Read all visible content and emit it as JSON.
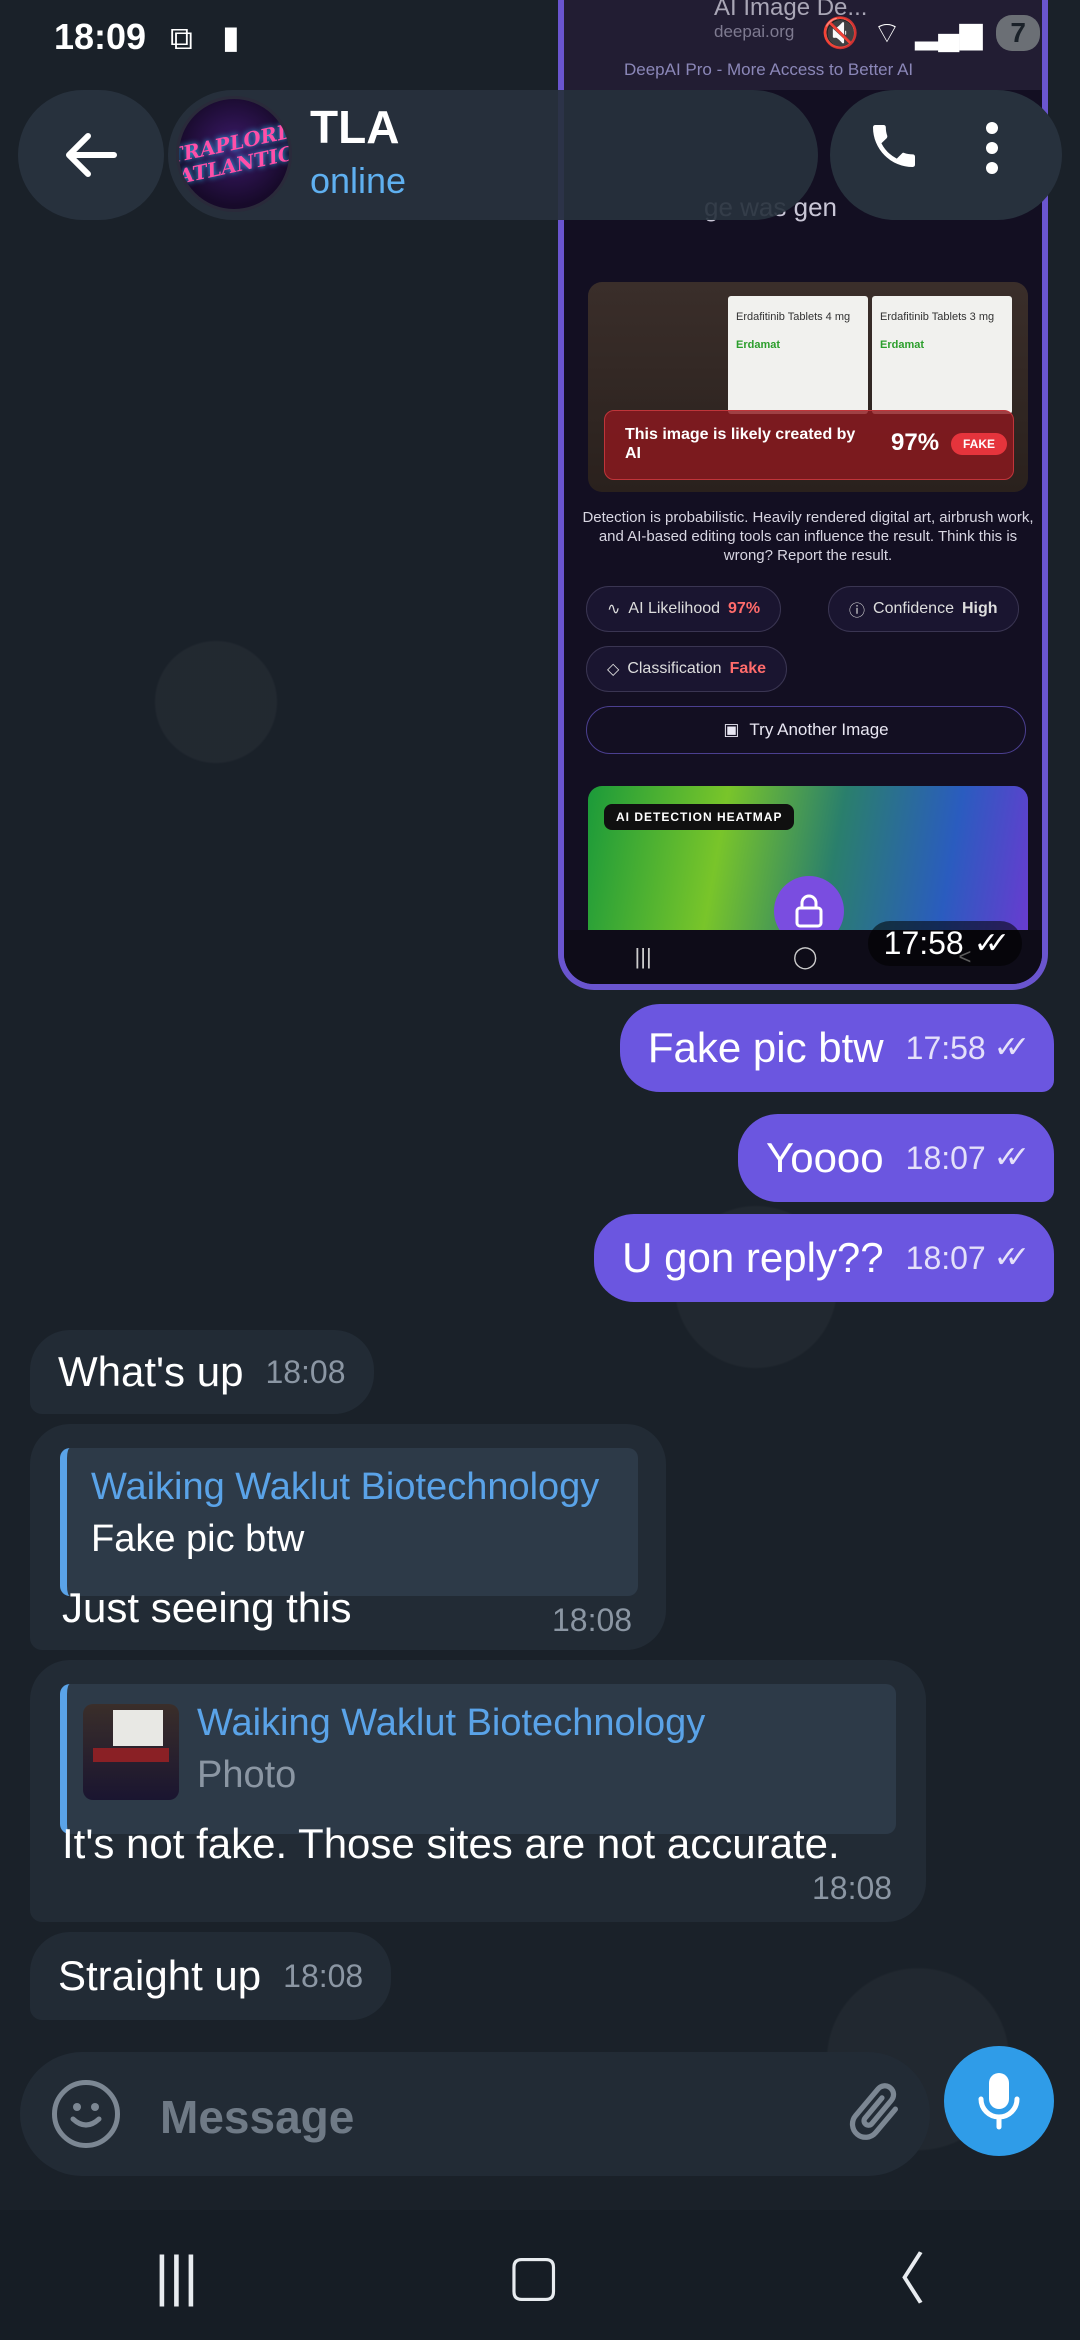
{
  "status_bar": {
    "time": "18:09",
    "icons": [
      "screen-record-icon",
      "alert-icon",
      "mute-icon",
      "wifi-icon",
      "signal-icon"
    ],
    "battery": "7"
  },
  "header": {
    "title": "TLA",
    "status": "online",
    "avatar_text": "TRAPLORD ATLANTIC"
  },
  "screenshot_message": {
    "site_title": "AI Image De...",
    "site_url": "deepai.org",
    "promo": "DeepAI Pro - More Access to Better AI",
    "caption_fragment": "ge was gen",
    "product_label_1": "Erdafitinib Tablets 4 mg",
    "product_label_2": "Erdafitinib Tablets 3 mg",
    "brand": "Erdamat",
    "banner_text": "This image is likely created by AI",
    "banner_percent": "97%",
    "banner_badge": "FAKE",
    "detection_note": "Detection is probabilistic. Heavily rendered digital art, airbrush work, and AI-based editing tools can influence the result. Think this is wrong? Report the result.",
    "chips": [
      {
        "label": "AI Likelihood",
        "value": "97%"
      },
      {
        "label": "Confidence",
        "value": "High"
      },
      {
        "label": "Classification",
        "value": "Fake"
      }
    ],
    "try_button": "Try Another Image",
    "heatmap_label": "AI DETECTION HEATMAP",
    "time": "17:58"
  },
  "messages": [
    {
      "direction": "out",
      "text": "Fake pic btw",
      "time": "17:58"
    },
    {
      "direction": "out",
      "text": "Yoooo",
      "time": "18:07"
    },
    {
      "direction": "out",
      "text": "U gon reply??",
      "time": "18:07"
    },
    {
      "direction": "in",
      "text": "What's up",
      "time": "18:08"
    },
    {
      "direction": "in",
      "reply_to": {
        "name": "Waiking Waklut Biotechnology",
        "text": "Fake pic btw"
      },
      "text": "Just seeing this",
      "time": "18:08"
    },
    {
      "direction": "in",
      "reply_to": {
        "name": "Waiking Waklut Biotechnology",
        "text": "Photo"
      },
      "text": "It's not fake. Those sites are not accurate.",
      "time": "18:08"
    },
    {
      "direction": "in",
      "text": "Straight up",
      "time": "18:08"
    }
  ],
  "composer": {
    "placeholder": "Message"
  },
  "colors": {
    "outgoing": "#6b56e0",
    "incoming": "#222b35",
    "accent": "#2f9ce8",
    "link": "#5aa3e8"
  }
}
